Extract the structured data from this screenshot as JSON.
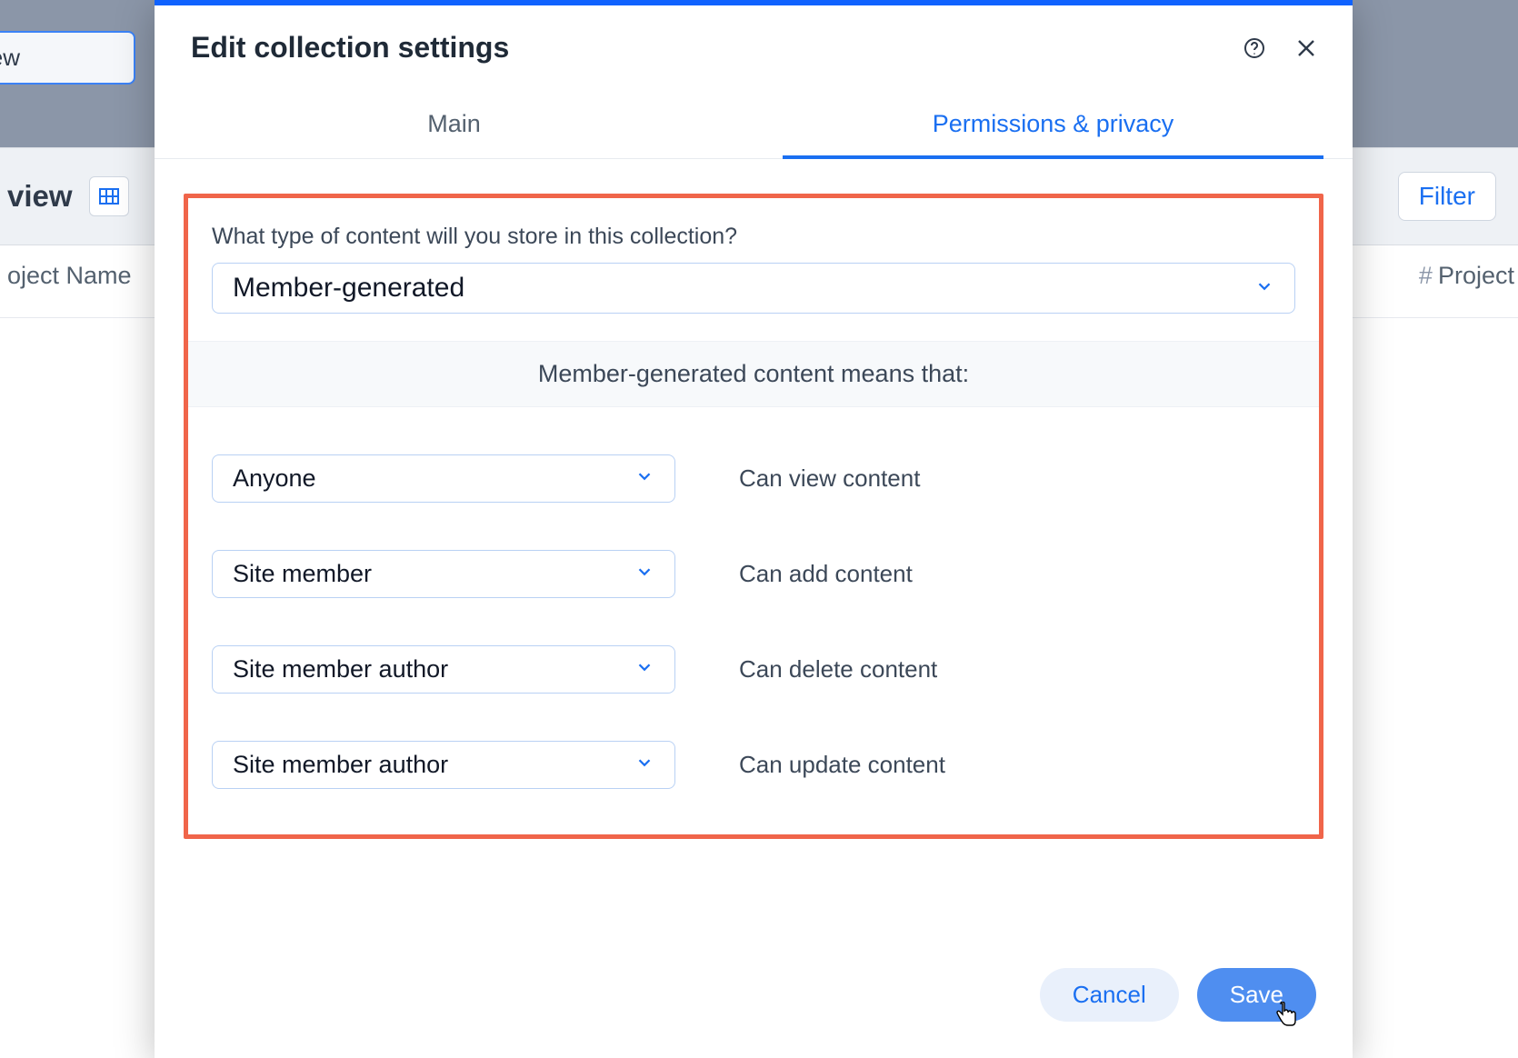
{
  "background": {
    "chip1": "view",
    "toolbar_view": "view",
    "filter_label": "Filter",
    "col_left": "oject Name",
    "col_right": "Project"
  },
  "modal": {
    "title": "Edit collection settings",
    "tabs": {
      "main": "Main",
      "permissions": "Permissions & privacy"
    },
    "question": "What type of content will you store in this collection?",
    "content_type_value": "Member-generated",
    "subheader": "Member-generated content means that:",
    "permissions": [
      {
        "role": "Anyone",
        "desc": "Can view content"
      },
      {
        "role": "Site member",
        "desc": "Can add content"
      },
      {
        "role": "Site member author",
        "desc": "Can delete content"
      },
      {
        "role": "Site member author",
        "desc": "Can update content"
      }
    ],
    "footer": {
      "cancel": "Cancel",
      "save": "Save"
    }
  }
}
